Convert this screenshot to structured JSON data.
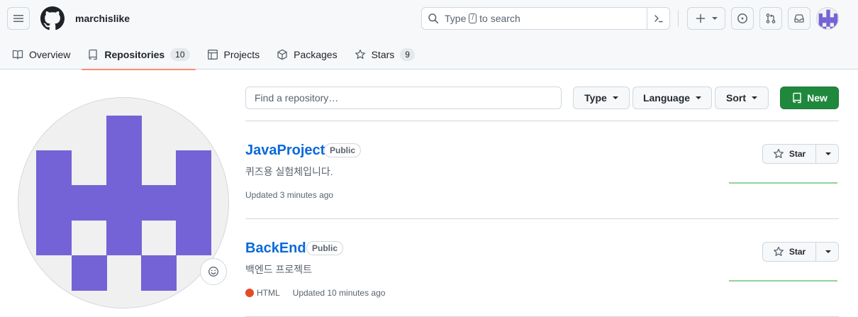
{
  "header": {
    "owner": "marchislike",
    "search": {
      "prefix": "Type",
      "key": "/",
      "suffix": "to search"
    },
    "icons": [
      "menu-icon",
      "github-logo-icon",
      "search-icon",
      "command-palette-icon",
      "plus-icon",
      "issue-icon",
      "pull-request-icon",
      "inbox-icon"
    ]
  },
  "tabs": [
    {
      "label": "Overview",
      "icon": "book-icon"
    },
    {
      "label": "Repositories",
      "icon": "repo-icon",
      "count": "10",
      "selected": true
    },
    {
      "label": "Projects",
      "icon": "table-icon"
    },
    {
      "label": "Packages",
      "icon": "package-icon"
    },
    {
      "label": "Stars",
      "icon": "star-icon",
      "count": "9"
    }
  ],
  "filters": {
    "find_placeholder": "Find a repository…",
    "type_label": "Type",
    "language_label": "Language",
    "sort_label": "Sort",
    "new_label": "New"
  },
  "repos": [
    {
      "name": "JavaProject",
      "visibility": "Public",
      "description": "퀴즈용 실험체입니다.",
      "updated": "Updated 3 minutes ago",
      "star_label": "Star"
    },
    {
      "name": "BackEnd",
      "visibility": "Public",
      "description": "백엔드 프로젝트",
      "language": "HTML",
      "language_color": "#e34c26",
      "updated": "Updated 10 minutes ago",
      "star_label": "Star"
    }
  ],
  "colors": {
    "accent_blue": "#0969da",
    "new_button_green": "#1f883d",
    "tab_underline": "#fd8c73",
    "avatar_purple": "#7463d6",
    "sparkline_green": "#8fd39d"
  }
}
